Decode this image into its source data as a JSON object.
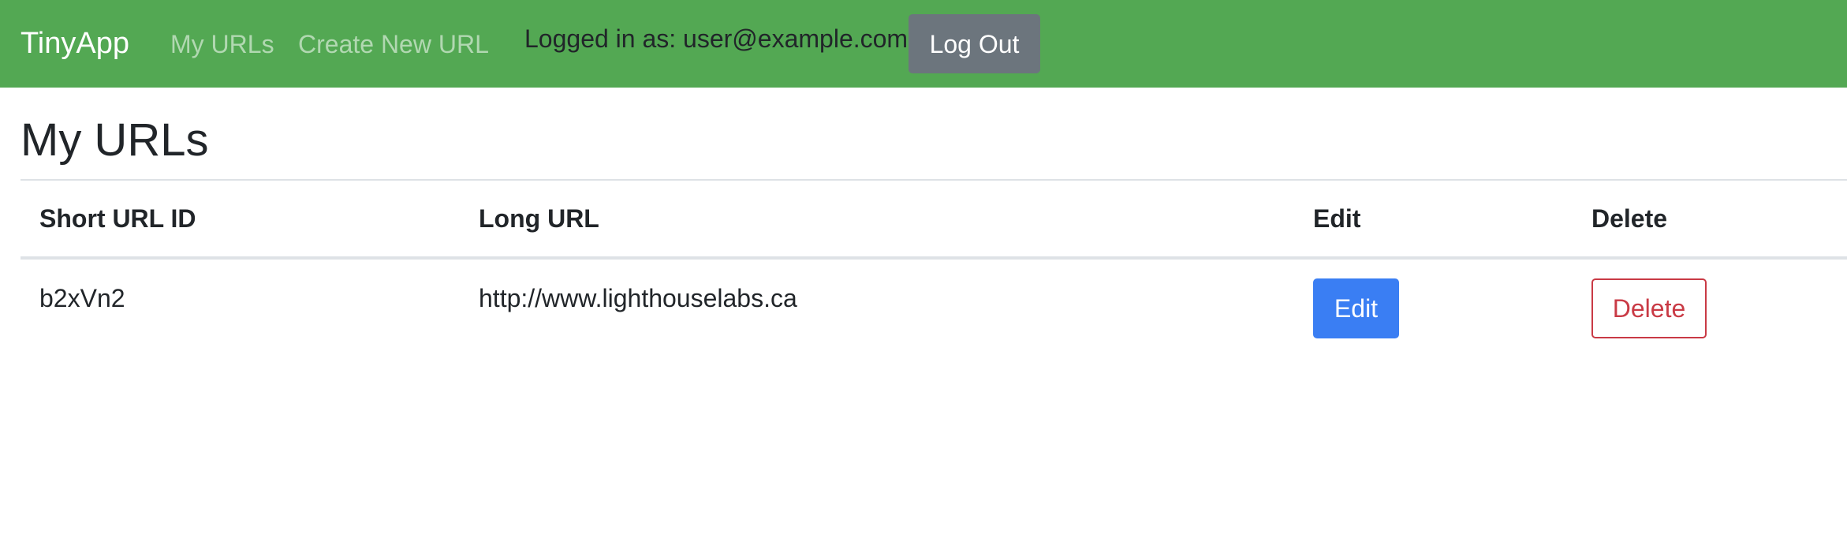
{
  "navbar": {
    "brand": "TinyApp",
    "links": [
      {
        "label": "My URLs"
      },
      {
        "label": "Create New URL"
      }
    ],
    "logged_in_text": "Logged in as: user@example.com",
    "logout_label": "Log Out",
    "background_color": "#53a853"
  },
  "main": {
    "title": "My URLs",
    "table": {
      "headers": [
        "Short URL ID",
        "Long URL",
        "Edit",
        "Delete"
      ],
      "rows": [
        {
          "short_id": "b2xVn2",
          "long_url": "http://www.lighthouselabs.ca",
          "edit_label": "Edit",
          "delete_label": "Delete"
        }
      ]
    }
  },
  "colors": {
    "edit_button": "#3a7ef3",
    "delete_button": "#c93a45",
    "logout_button": "#6c757d"
  }
}
